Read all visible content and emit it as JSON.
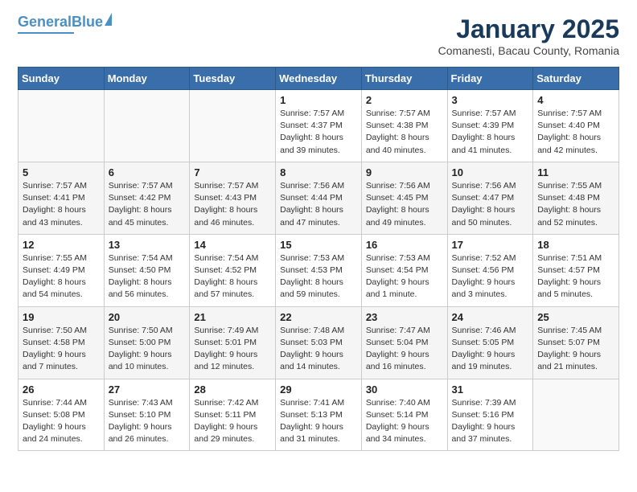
{
  "header": {
    "logo_line1": "General",
    "logo_line2": "Blue",
    "month_year": "January 2025",
    "location": "Comanesti, Bacau County, Romania"
  },
  "calendar": {
    "days_of_week": [
      "Sunday",
      "Monday",
      "Tuesday",
      "Wednesday",
      "Thursday",
      "Friday",
      "Saturday"
    ],
    "weeks": [
      [
        {
          "day": "",
          "info": ""
        },
        {
          "day": "",
          "info": ""
        },
        {
          "day": "",
          "info": ""
        },
        {
          "day": "1",
          "info": "Sunrise: 7:57 AM\nSunset: 4:37 PM\nDaylight: 8 hours\nand 39 minutes."
        },
        {
          "day": "2",
          "info": "Sunrise: 7:57 AM\nSunset: 4:38 PM\nDaylight: 8 hours\nand 40 minutes."
        },
        {
          "day": "3",
          "info": "Sunrise: 7:57 AM\nSunset: 4:39 PM\nDaylight: 8 hours\nand 41 minutes."
        },
        {
          "day": "4",
          "info": "Sunrise: 7:57 AM\nSunset: 4:40 PM\nDaylight: 8 hours\nand 42 minutes."
        }
      ],
      [
        {
          "day": "5",
          "info": "Sunrise: 7:57 AM\nSunset: 4:41 PM\nDaylight: 8 hours\nand 43 minutes."
        },
        {
          "day": "6",
          "info": "Sunrise: 7:57 AM\nSunset: 4:42 PM\nDaylight: 8 hours\nand 45 minutes."
        },
        {
          "day": "7",
          "info": "Sunrise: 7:57 AM\nSunset: 4:43 PM\nDaylight: 8 hours\nand 46 minutes."
        },
        {
          "day": "8",
          "info": "Sunrise: 7:56 AM\nSunset: 4:44 PM\nDaylight: 8 hours\nand 47 minutes."
        },
        {
          "day": "9",
          "info": "Sunrise: 7:56 AM\nSunset: 4:45 PM\nDaylight: 8 hours\nand 49 minutes."
        },
        {
          "day": "10",
          "info": "Sunrise: 7:56 AM\nSunset: 4:47 PM\nDaylight: 8 hours\nand 50 minutes."
        },
        {
          "day": "11",
          "info": "Sunrise: 7:55 AM\nSunset: 4:48 PM\nDaylight: 8 hours\nand 52 minutes."
        }
      ],
      [
        {
          "day": "12",
          "info": "Sunrise: 7:55 AM\nSunset: 4:49 PM\nDaylight: 8 hours\nand 54 minutes."
        },
        {
          "day": "13",
          "info": "Sunrise: 7:54 AM\nSunset: 4:50 PM\nDaylight: 8 hours\nand 56 minutes."
        },
        {
          "day": "14",
          "info": "Sunrise: 7:54 AM\nSunset: 4:52 PM\nDaylight: 8 hours\nand 57 minutes."
        },
        {
          "day": "15",
          "info": "Sunrise: 7:53 AM\nSunset: 4:53 PM\nDaylight: 8 hours\nand 59 minutes."
        },
        {
          "day": "16",
          "info": "Sunrise: 7:53 AM\nSunset: 4:54 PM\nDaylight: 9 hours\nand 1 minute."
        },
        {
          "day": "17",
          "info": "Sunrise: 7:52 AM\nSunset: 4:56 PM\nDaylight: 9 hours\nand 3 minutes."
        },
        {
          "day": "18",
          "info": "Sunrise: 7:51 AM\nSunset: 4:57 PM\nDaylight: 9 hours\nand 5 minutes."
        }
      ],
      [
        {
          "day": "19",
          "info": "Sunrise: 7:50 AM\nSunset: 4:58 PM\nDaylight: 9 hours\nand 7 minutes."
        },
        {
          "day": "20",
          "info": "Sunrise: 7:50 AM\nSunset: 5:00 PM\nDaylight: 9 hours\nand 10 minutes."
        },
        {
          "day": "21",
          "info": "Sunrise: 7:49 AM\nSunset: 5:01 PM\nDaylight: 9 hours\nand 12 minutes."
        },
        {
          "day": "22",
          "info": "Sunrise: 7:48 AM\nSunset: 5:03 PM\nDaylight: 9 hours\nand 14 minutes."
        },
        {
          "day": "23",
          "info": "Sunrise: 7:47 AM\nSunset: 5:04 PM\nDaylight: 9 hours\nand 16 minutes."
        },
        {
          "day": "24",
          "info": "Sunrise: 7:46 AM\nSunset: 5:05 PM\nDaylight: 9 hours\nand 19 minutes."
        },
        {
          "day": "25",
          "info": "Sunrise: 7:45 AM\nSunset: 5:07 PM\nDaylight: 9 hours\nand 21 minutes."
        }
      ],
      [
        {
          "day": "26",
          "info": "Sunrise: 7:44 AM\nSunset: 5:08 PM\nDaylight: 9 hours\nand 24 minutes."
        },
        {
          "day": "27",
          "info": "Sunrise: 7:43 AM\nSunset: 5:10 PM\nDaylight: 9 hours\nand 26 minutes."
        },
        {
          "day": "28",
          "info": "Sunrise: 7:42 AM\nSunset: 5:11 PM\nDaylight: 9 hours\nand 29 minutes."
        },
        {
          "day": "29",
          "info": "Sunrise: 7:41 AM\nSunset: 5:13 PM\nDaylight: 9 hours\nand 31 minutes."
        },
        {
          "day": "30",
          "info": "Sunrise: 7:40 AM\nSunset: 5:14 PM\nDaylight: 9 hours\nand 34 minutes."
        },
        {
          "day": "31",
          "info": "Sunrise: 7:39 AM\nSunset: 5:16 PM\nDaylight: 9 hours\nand 37 minutes."
        },
        {
          "day": "",
          "info": ""
        }
      ]
    ]
  }
}
